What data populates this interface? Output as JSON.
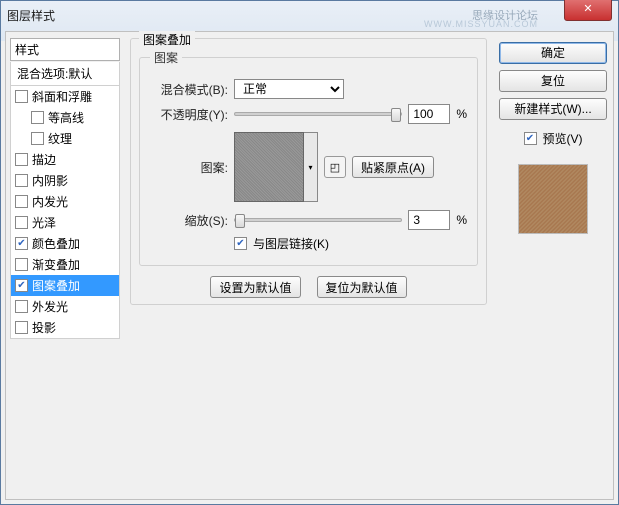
{
  "window": {
    "title": "图层样式",
    "watermark": "思缘设计论坛",
    "watermark2": "WWW.MISSYUAN.COM"
  },
  "left": {
    "header": "样式",
    "blend": "混合选项:默认",
    "items": [
      {
        "label": "斜面和浮雕",
        "checked": false,
        "indent": false
      },
      {
        "label": "等高线",
        "checked": false,
        "indent": true
      },
      {
        "label": "纹理",
        "checked": false,
        "indent": true
      },
      {
        "label": "描边",
        "checked": false,
        "indent": false
      },
      {
        "label": "内阴影",
        "checked": false,
        "indent": false
      },
      {
        "label": "内发光",
        "checked": false,
        "indent": false
      },
      {
        "label": "光泽",
        "checked": false,
        "indent": false
      },
      {
        "label": "颜色叠加",
        "checked": true,
        "indent": false
      },
      {
        "label": "渐变叠加",
        "checked": false,
        "indent": false
      },
      {
        "label": "图案叠加",
        "checked": true,
        "indent": false,
        "selected": true
      },
      {
        "label": "外发光",
        "checked": false,
        "indent": false
      },
      {
        "label": "投影",
        "checked": false,
        "indent": false
      }
    ]
  },
  "mid": {
    "group_outer": "图案叠加",
    "group_inner": "图案",
    "blend_label": "混合模式(B):",
    "blend_value": "正常",
    "opacity_label": "不透明度(Y):",
    "opacity_value": "100",
    "pct": "%",
    "pattern_label": "图案:",
    "snap_btn": "贴紧原点(A)",
    "scale_label": "缩放(S):",
    "scale_value": "3",
    "link_label": "与图层链接(K)",
    "link_checked": true,
    "default_set": "设置为默认值",
    "default_reset": "复位为默认值"
  },
  "right": {
    "ok": "确定",
    "cancel": "复位",
    "newstyle": "新建样式(W)...",
    "preview_label": "预览(V)",
    "preview_checked": true
  }
}
